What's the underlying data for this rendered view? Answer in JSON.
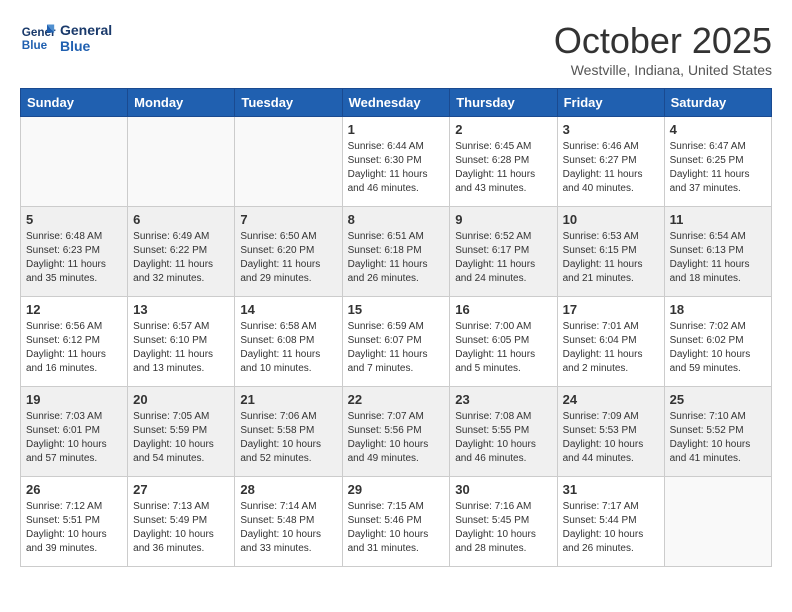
{
  "header": {
    "logo_line1": "General",
    "logo_line2": "Blue",
    "month": "October 2025",
    "location": "Westville, Indiana, United States"
  },
  "days_of_week": [
    "Sunday",
    "Monday",
    "Tuesday",
    "Wednesday",
    "Thursday",
    "Friday",
    "Saturday"
  ],
  "weeks": [
    [
      {
        "day": "",
        "info": ""
      },
      {
        "day": "",
        "info": ""
      },
      {
        "day": "",
        "info": ""
      },
      {
        "day": "1",
        "info": "Sunrise: 6:44 AM\nSunset: 6:30 PM\nDaylight: 11 hours\nand 46 minutes."
      },
      {
        "day": "2",
        "info": "Sunrise: 6:45 AM\nSunset: 6:28 PM\nDaylight: 11 hours\nand 43 minutes."
      },
      {
        "day": "3",
        "info": "Sunrise: 6:46 AM\nSunset: 6:27 PM\nDaylight: 11 hours\nand 40 minutes."
      },
      {
        "day": "4",
        "info": "Sunrise: 6:47 AM\nSunset: 6:25 PM\nDaylight: 11 hours\nand 37 minutes."
      }
    ],
    [
      {
        "day": "5",
        "info": "Sunrise: 6:48 AM\nSunset: 6:23 PM\nDaylight: 11 hours\nand 35 minutes."
      },
      {
        "day": "6",
        "info": "Sunrise: 6:49 AM\nSunset: 6:22 PM\nDaylight: 11 hours\nand 32 minutes."
      },
      {
        "day": "7",
        "info": "Sunrise: 6:50 AM\nSunset: 6:20 PM\nDaylight: 11 hours\nand 29 minutes."
      },
      {
        "day": "8",
        "info": "Sunrise: 6:51 AM\nSunset: 6:18 PM\nDaylight: 11 hours\nand 26 minutes."
      },
      {
        "day": "9",
        "info": "Sunrise: 6:52 AM\nSunset: 6:17 PM\nDaylight: 11 hours\nand 24 minutes."
      },
      {
        "day": "10",
        "info": "Sunrise: 6:53 AM\nSunset: 6:15 PM\nDaylight: 11 hours\nand 21 minutes."
      },
      {
        "day": "11",
        "info": "Sunrise: 6:54 AM\nSunset: 6:13 PM\nDaylight: 11 hours\nand 18 minutes."
      }
    ],
    [
      {
        "day": "12",
        "info": "Sunrise: 6:56 AM\nSunset: 6:12 PM\nDaylight: 11 hours\nand 16 minutes."
      },
      {
        "day": "13",
        "info": "Sunrise: 6:57 AM\nSunset: 6:10 PM\nDaylight: 11 hours\nand 13 minutes."
      },
      {
        "day": "14",
        "info": "Sunrise: 6:58 AM\nSunset: 6:08 PM\nDaylight: 11 hours\nand 10 minutes."
      },
      {
        "day": "15",
        "info": "Sunrise: 6:59 AM\nSunset: 6:07 PM\nDaylight: 11 hours\nand 7 minutes."
      },
      {
        "day": "16",
        "info": "Sunrise: 7:00 AM\nSunset: 6:05 PM\nDaylight: 11 hours\nand 5 minutes."
      },
      {
        "day": "17",
        "info": "Sunrise: 7:01 AM\nSunset: 6:04 PM\nDaylight: 11 hours\nand 2 minutes."
      },
      {
        "day": "18",
        "info": "Sunrise: 7:02 AM\nSunset: 6:02 PM\nDaylight: 10 hours\nand 59 minutes."
      }
    ],
    [
      {
        "day": "19",
        "info": "Sunrise: 7:03 AM\nSunset: 6:01 PM\nDaylight: 10 hours\nand 57 minutes."
      },
      {
        "day": "20",
        "info": "Sunrise: 7:05 AM\nSunset: 5:59 PM\nDaylight: 10 hours\nand 54 minutes."
      },
      {
        "day": "21",
        "info": "Sunrise: 7:06 AM\nSunset: 5:58 PM\nDaylight: 10 hours\nand 52 minutes."
      },
      {
        "day": "22",
        "info": "Sunrise: 7:07 AM\nSunset: 5:56 PM\nDaylight: 10 hours\nand 49 minutes."
      },
      {
        "day": "23",
        "info": "Sunrise: 7:08 AM\nSunset: 5:55 PM\nDaylight: 10 hours\nand 46 minutes."
      },
      {
        "day": "24",
        "info": "Sunrise: 7:09 AM\nSunset: 5:53 PM\nDaylight: 10 hours\nand 44 minutes."
      },
      {
        "day": "25",
        "info": "Sunrise: 7:10 AM\nSunset: 5:52 PM\nDaylight: 10 hours\nand 41 minutes."
      }
    ],
    [
      {
        "day": "26",
        "info": "Sunrise: 7:12 AM\nSunset: 5:51 PM\nDaylight: 10 hours\nand 39 minutes."
      },
      {
        "day": "27",
        "info": "Sunrise: 7:13 AM\nSunset: 5:49 PM\nDaylight: 10 hours\nand 36 minutes."
      },
      {
        "day": "28",
        "info": "Sunrise: 7:14 AM\nSunset: 5:48 PM\nDaylight: 10 hours\nand 33 minutes."
      },
      {
        "day": "29",
        "info": "Sunrise: 7:15 AM\nSunset: 5:46 PM\nDaylight: 10 hours\nand 31 minutes."
      },
      {
        "day": "30",
        "info": "Sunrise: 7:16 AM\nSunset: 5:45 PM\nDaylight: 10 hours\nand 28 minutes."
      },
      {
        "day": "31",
        "info": "Sunrise: 7:17 AM\nSunset: 5:44 PM\nDaylight: 10 hours\nand 26 minutes."
      },
      {
        "day": "",
        "info": ""
      }
    ]
  ]
}
